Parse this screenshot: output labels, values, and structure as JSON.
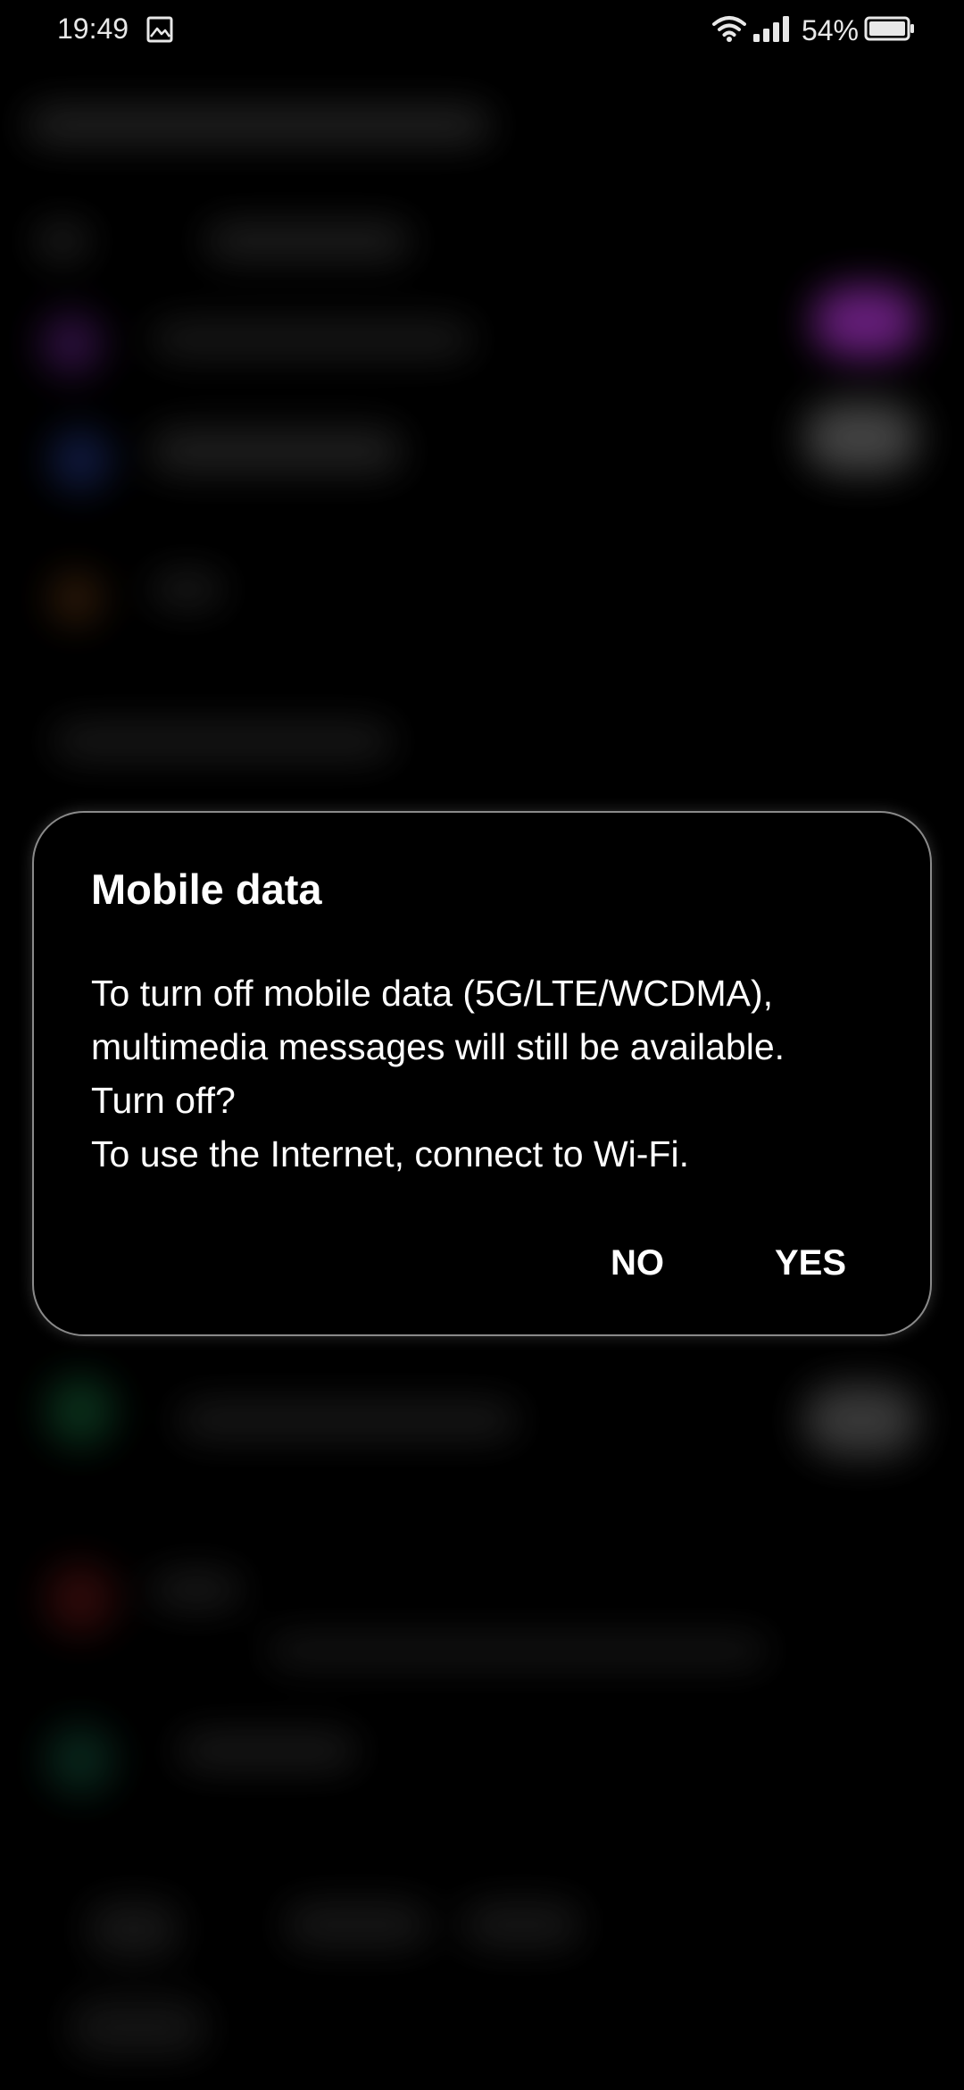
{
  "status_bar": {
    "time": "19:49",
    "notification_icon": "image-icon",
    "wifi_icon": "wifi-icon",
    "signal_icon": "signal-bars-icon",
    "battery_percent": "54%",
    "battery_icon": "battery-icon"
  },
  "dialog": {
    "title": "Mobile data",
    "message_lines": [
      "To turn off mobile data (5G/LTE/WCDMA),",
      "multimedia messages will still be available.",
      "Turn off?",
      "To use the Internet, connect to Wi-Fi."
    ],
    "buttons": {
      "no": "NO",
      "yes": "YES"
    }
  },
  "colors": {
    "background": "#000000",
    "dialog_border": "#8a8a8a",
    "text": "#ffffff"
  }
}
